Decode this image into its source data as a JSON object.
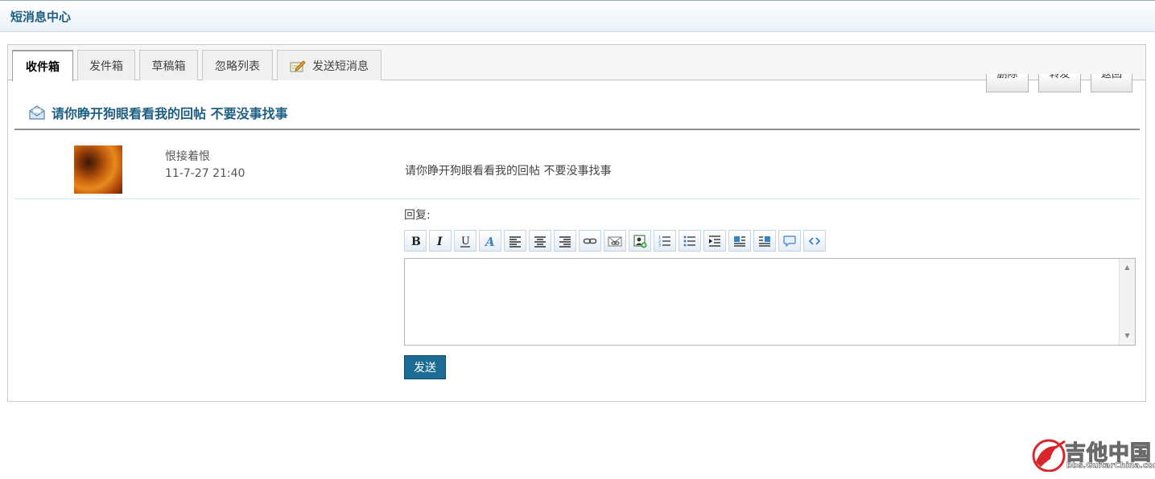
{
  "header": {
    "title": "短消息中心"
  },
  "tabs": [
    {
      "label": "收件箱",
      "active": true
    },
    {
      "label": "发件箱",
      "active": false
    },
    {
      "label": "草稿箱",
      "active": false
    },
    {
      "label": "忽略列表",
      "active": false
    },
    {
      "label": "发送短消息",
      "active": false,
      "icon": "compose-icon"
    }
  ],
  "actions": {
    "delete_label": "删除",
    "forward_label": "转发",
    "back_label": "返回"
  },
  "message": {
    "subject": "请你睁开狗眼看看我的回帖 不要没事找事",
    "sender": "恨接着恨",
    "time": "11-7-27 21:40",
    "body": "请你睁开狗眼看看我的回帖  不要没事找事"
  },
  "reply": {
    "label": "回复:",
    "value": "",
    "toolbar": [
      "bold-icon",
      "italic-icon",
      "underline-icon",
      "font-color-icon",
      "align-left-icon",
      "align-center-icon",
      "align-right-icon",
      "link-icon",
      "unlink-icon",
      "insert-image-icon",
      "ordered-list-icon",
      "unordered-list-icon",
      "indent-icon",
      "float-left-icon",
      "float-right-icon",
      "quote-icon",
      "code-icon"
    ],
    "send_label": "发送"
  },
  "watermark": {
    "name": "吉他中国",
    "url": "bbs.GuitarChina.com"
  },
  "colors": {
    "accent": "#1d5e82",
    "send_button": "#1b6b95",
    "watermark_red": "#d8262b"
  }
}
